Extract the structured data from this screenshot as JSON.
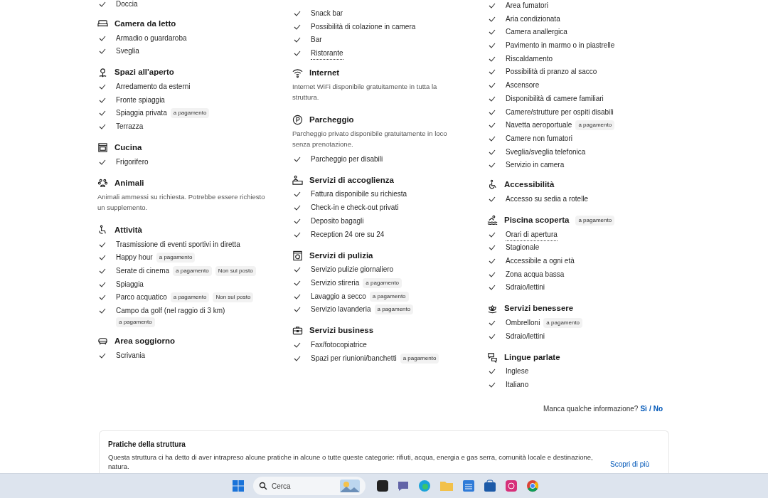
{
  "columns": [
    {
      "items": [
        {
          "label": "Doccia"
        }
      ],
      "sections": [
        {
          "title": "Camera da letto",
          "items": [
            {
              "label": "Armadio o guardaroba"
            },
            {
              "label": "Sveglia"
            }
          ]
        },
        {
          "title": "Spazi all'aperto",
          "items": [
            {
              "label": "Arredamento da esterni"
            },
            {
              "label": "Fronte spiaggia"
            },
            {
              "label": "Spiaggia privata",
              "tags": [
                "a pagamento"
              ]
            },
            {
              "label": "Terrazza"
            }
          ]
        },
        {
          "title": "Cucina",
          "items": [
            {
              "label": "Frigorifero"
            }
          ]
        },
        {
          "title": "Animali",
          "description": "Animali ammessi su richiesta. Potrebbe essere richiesto un supplemento."
        },
        {
          "title": "Attività",
          "items": [
            {
              "label": "Trasmissione di eventi sportivi in diretta"
            },
            {
              "label": "Happy hour",
              "tags": [
                "a pagamento"
              ]
            },
            {
              "label": "Serate di cinema",
              "tags": [
                "a pagamento",
                "Non sul posto"
              ]
            },
            {
              "label": "Spiaggia"
            },
            {
              "label": "Parco acquatico",
              "tags": [
                "a pagamento",
                "Non sul posto"
              ]
            },
            {
              "label": "Campo da golf (nel raggio di 3 km)",
              "tags": [
                "a pagamento"
              ]
            }
          ]
        },
        {
          "title": "Area soggiorno",
          "items": [
            {
              "label": "Scrivania"
            }
          ]
        }
      ]
    },
    {
      "items": [
        {
          "label": "Snack bar"
        },
        {
          "label": "Possibilità di colazione in camera"
        },
        {
          "label": "Bar"
        },
        {
          "label": "Ristorante",
          "dotted": true
        }
      ],
      "sections": [
        {
          "title": "Internet",
          "description": "Internet WiFi disponibile gratuitamente in tutta la struttura."
        },
        {
          "title": "Parcheggio",
          "description": "Parcheggio privato disponibile gratuitamente in loco senza prenotazione.",
          "items": [
            {
              "label": "Parcheggio per disabili"
            }
          ]
        },
        {
          "title": "Servizi di accoglienza",
          "items": [
            {
              "label": "Fattura disponibile su richiesta"
            },
            {
              "label": "Check-in e check-out privati"
            },
            {
              "label": "Deposito bagagli"
            },
            {
              "label": "Reception 24 ore su 24"
            }
          ]
        },
        {
          "title": "Servizi di pulizia",
          "items": [
            {
              "label": "Servizio pulizie giornaliero"
            },
            {
              "label": "Servizio stireria",
              "tags": [
                "a pagamento"
              ]
            },
            {
              "label": "Lavaggio a secco",
              "tags": [
                "a pagamento"
              ]
            },
            {
              "label": "Servizio lavanderia",
              "tags": [
                "a pagamento"
              ]
            }
          ]
        },
        {
          "title": "Servizi business",
          "items": [
            {
              "label": "Fax/fotocopiatrice"
            },
            {
              "label": "Spazi per riunioni/banchetti",
              "tags": [
                "a pagamento"
              ]
            }
          ]
        }
      ]
    },
    {
      "items": [
        {
          "label": "Area fumatori"
        },
        {
          "label": "Aria condizionata"
        },
        {
          "label": "Camera anallergica"
        },
        {
          "label": "Pavimento in marmo o in piastrelle"
        },
        {
          "label": "Riscaldamento"
        },
        {
          "label": "Possibilità di pranzo al sacco"
        },
        {
          "label": "Ascensore"
        },
        {
          "label": "Disponibilità di camere familiari"
        },
        {
          "label": "Camere/strutture per ospiti disabili"
        },
        {
          "label": "Navetta aeroportuale",
          "tags": [
            "a pagamento"
          ]
        },
        {
          "label": "Camere non fumatori"
        },
        {
          "label": "Sveglia/sveglia telefonica"
        },
        {
          "label": "Servizio in camera"
        }
      ],
      "sections": [
        {
          "title": "Accessibilità",
          "items": [
            {
              "label": "Accesso su sedia a rotelle"
            }
          ]
        },
        {
          "title": "Piscina scoperta",
          "tag": "a pagamento",
          "items": [
            {
              "label": "Orari di apertura",
              "dotted": true
            },
            {
              "label": "Stagionale"
            },
            {
              "label": "Accessibile a ogni età"
            },
            {
              "label": "Zona acqua bassa"
            },
            {
              "label": "Sdraio/lettini"
            }
          ]
        },
        {
          "title": "Servizi benessere",
          "items": [
            {
              "label": "Ombrelloni",
              "tags": [
                "a pagamento"
              ]
            },
            {
              "label": "Sdraio/lettini"
            }
          ]
        },
        {
          "title": "Lingue parlate",
          "items": [
            {
              "label": "Inglese"
            },
            {
              "label": "Italiano"
            }
          ]
        }
      ]
    }
  ],
  "feedback": {
    "question": "Manca qualche informazione?",
    "yes": "Sì",
    "separator": "/",
    "no": "No"
  },
  "practices": {
    "title": "Pratiche della struttura",
    "text": "Questa struttura ci ha detto di aver intrapreso alcune pratiche in alcune o tutte queste categorie: rifiuti, acqua, energia e gas serra, comunità locale e destinazione, natura.",
    "link": "Scopri di più"
  },
  "taskbar": {
    "search_placeholder": "Cerca"
  }
}
